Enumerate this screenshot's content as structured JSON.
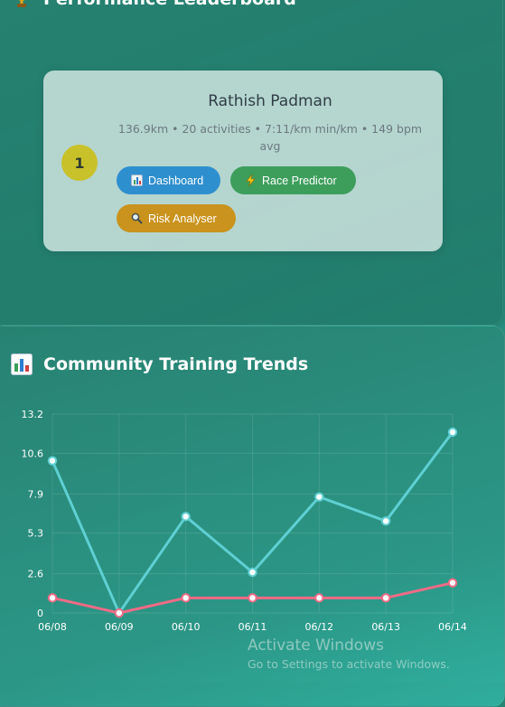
{
  "leaderboard": {
    "title": "Performance Leaderboard",
    "icon": "trophy-icon",
    "entries": [
      {
        "rank": "1",
        "name": "Rathish Padman",
        "stats": "136.9km • 20 activities • 7:11/km min/km • 149 bpm avg",
        "buttons": {
          "dashboard": "Dashboard",
          "race_predictor": "Race Predictor",
          "risk_analyser": "Risk Analyser"
        }
      }
    ]
  },
  "trends": {
    "title": "Community Training Trends",
    "icon": "bar-chart-icon"
  },
  "chart_data": {
    "type": "line",
    "x": [
      "06/08",
      "06/09",
      "06/10",
      "06/11",
      "06/12",
      "06/13",
      "06/14"
    ],
    "yticks": [
      "0",
      "2.6",
      "5.3",
      "7.9",
      "10.6",
      "13.2"
    ],
    "ylim": [
      0,
      13.2
    ],
    "grid": true,
    "series": [
      {
        "values": [
          10.1,
          0,
          6.4,
          2.7,
          7.7,
          6.1,
          12.0
        ],
        "color": "#5fd0d2"
      },
      {
        "values": [
          1,
          0,
          1,
          1,
          1,
          1,
          2
        ],
        "color": "#ef6b86"
      }
    ]
  },
  "watermark": {
    "title": "Activate Windows",
    "subtitle": "Go to Settings to activate Windows."
  }
}
